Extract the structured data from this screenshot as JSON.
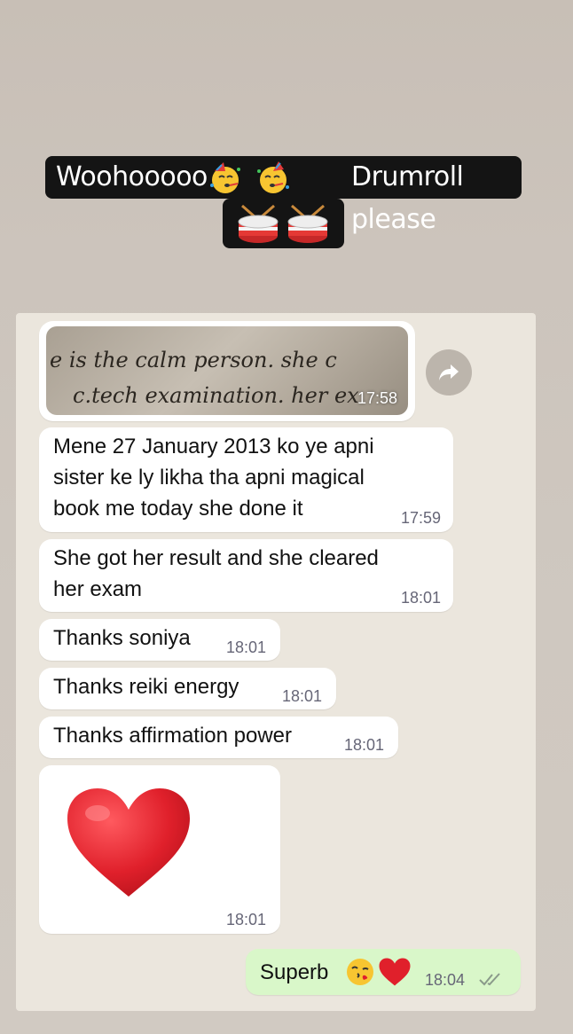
{
  "caption": {
    "line1_start": "Woohooooo",
    "line1_end": "Drumroll please",
    "emoji_left": "partying-face-emoji",
    "emoji_right": "drum-emoji"
  },
  "messages": [
    {
      "type": "image",
      "time": "17:58"
    },
    {
      "type": "text",
      "lines": [
        "Mene 27 January 2013 ko ye apni",
        "sister ke ly likha tha apni magical",
        "book me today she done it"
      ],
      "time": "17:59"
    },
    {
      "type": "text",
      "lines": [
        "She got her result and she cleared",
        "her exam"
      ],
      "time": "18:01"
    },
    {
      "type": "text",
      "lines": [
        "Thanks soniya"
      ],
      "time": "18:01"
    },
    {
      "type": "text",
      "lines": [
        "Thanks reiki energy"
      ],
      "time": "18:01"
    },
    {
      "type": "text",
      "lines": [
        "Thanks affirmation power"
      ],
      "time": "18:01"
    },
    {
      "type": "sticker",
      "icon": "red-heart-icon",
      "time": "18:01"
    },
    {
      "type": "outgoing",
      "text": "Superb",
      "time": "18:04"
    }
  ],
  "handwriting": {
    "line1": "e is the calm person. she c",
    "line2": "c.tech examination. her ex"
  },
  "colors": {
    "outgoing_bubble": "#d9f7c9",
    "incoming_bubble": "#ffffff",
    "caption_bg": "#141414",
    "heart": "#e0202b"
  }
}
